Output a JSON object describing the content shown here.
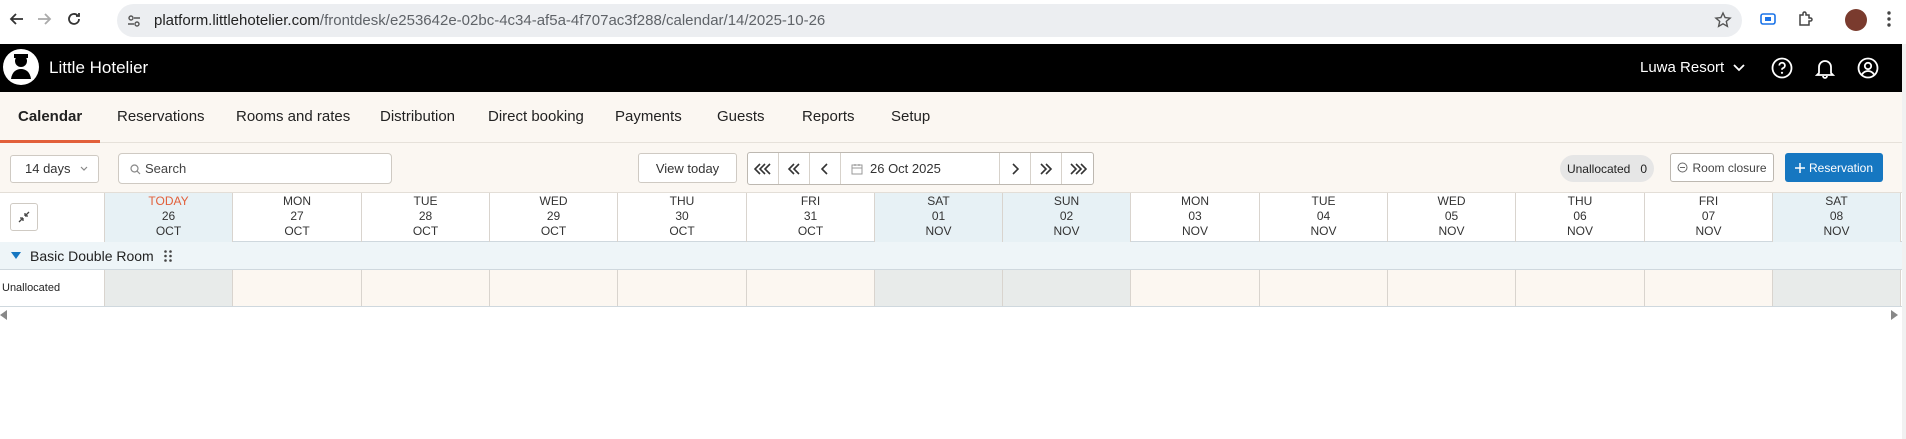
{
  "browser": {
    "url_host": "platform.littlehotelier.com",
    "url_path": "/frontdesk/e253642e-02bc-4c34-af5a-4f707ac3f288/calendar/14/2025-10-26"
  },
  "header": {
    "brand": "Little Hotelier",
    "property": "Luwa Resort"
  },
  "tabs": [
    {
      "label": "Calendar",
      "active": true
    },
    {
      "label": "Reservations"
    },
    {
      "label": "Rooms and rates"
    },
    {
      "label": "Distribution"
    },
    {
      "label": "Direct booking"
    },
    {
      "label": "Payments"
    },
    {
      "label": "Guests"
    },
    {
      "label": "Reports"
    },
    {
      "label": "Setup"
    }
  ],
  "toolbar": {
    "range_select": "14 days",
    "search_placeholder": "Search",
    "view_today": "View today",
    "current_date": "26 Oct 2025",
    "unallocated_label": "Unallocated",
    "unallocated_count": "0",
    "room_closure": "Room closure",
    "reservation": "Reservation"
  },
  "calendar": {
    "days": [
      {
        "dow": "TODAY",
        "day": "26",
        "month": "OCT"
      },
      {
        "dow": "MON",
        "day": "27",
        "month": "OCT"
      },
      {
        "dow": "TUE",
        "day": "28",
        "month": "OCT"
      },
      {
        "dow": "WED",
        "day": "29",
        "month": "OCT"
      },
      {
        "dow": "THU",
        "day": "30",
        "month": "OCT"
      },
      {
        "dow": "FRI",
        "day": "31",
        "month": "OCT"
      },
      {
        "dow": "SAT",
        "day": "01",
        "month": "NOV"
      },
      {
        "dow": "SUN",
        "day": "02",
        "month": "NOV"
      },
      {
        "dow": "MON",
        "day": "03",
        "month": "NOV"
      },
      {
        "dow": "TUE",
        "day": "04",
        "month": "NOV"
      },
      {
        "dow": "WED",
        "day": "05",
        "month": "NOV"
      },
      {
        "dow": "THU",
        "day": "06",
        "month": "NOV"
      },
      {
        "dow": "FRI",
        "day": "07",
        "month": "NOV"
      },
      {
        "dow": "SAT",
        "day": "08",
        "month": "NOV"
      }
    ],
    "room_type": "Basic Double Room",
    "row_label": "Unallocated"
  },
  "colors": {
    "accent": "#e2603b",
    "primary": "#1677c1",
    "header_bg": "#000000"
  }
}
